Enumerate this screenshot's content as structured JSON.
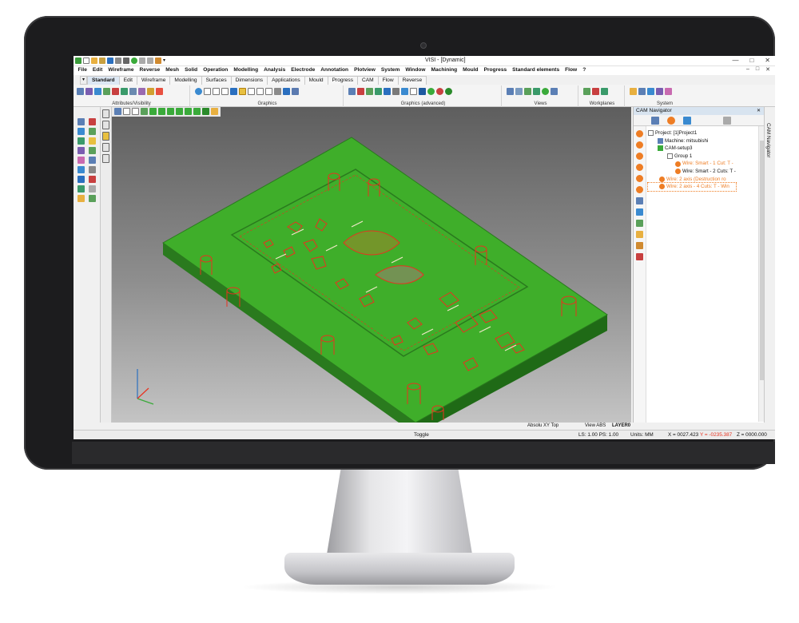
{
  "window": {
    "title": "VISI  - [Dynamic]",
    "controls": [
      "—",
      "□",
      "✕"
    ],
    "mdi_controls": [
      "–",
      "□",
      "✕"
    ]
  },
  "menu": [
    "File",
    "Edit",
    "Wireframe",
    "Reverse",
    "Mesh",
    "Solid",
    "Operation",
    "Modelling",
    "Analysis",
    "Electrode",
    "Annotation",
    "Plotview",
    "System",
    "Window",
    "Machining",
    "Mould",
    "Progress",
    "Standard elements",
    "Flow",
    "?"
  ],
  "ribbon_tabs": [
    {
      "label": "Standard",
      "active": true
    },
    {
      "label": "Edit"
    },
    {
      "label": "Wireframe"
    },
    {
      "label": "Modelling"
    },
    {
      "label": "Surfaces"
    },
    {
      "label": "Dimensions"
    },
    {
      "label": "Applications"
    },
    {
      "label": "Mould"
    },
    {
      "label": "Progress"
    },
    {
      "label": "CAM"
    },
    {
      "label": "Flow"
    },
    {
      "label": "Reverse"
    }
  ],
  "ribbon_groups": {
    "attributes": "Attributes/Visibility",
    "graphics": "Graphics",
    "graphics_adv": "Graphics (advanced)",
    "views": "Views",
    "workplanes": "Workplanes",
    "system": "System"
  },
  "cam_navigator": {
    "title": "CAM Navigator",
    "side_tab": "CAM Navigator",
    "tree": {
      "project": "Project: [1]Project1",
      "machine": "Machine: mitsubishi",
      "setup": "CAM-setup3",
      "group": "Group 1",
      "op1": "Wire: Smart - 1 Cut: T -",
      "op2": "Wire: Smart - 2 Cuts: T -",
      "op3": "Wire: 2 axis (Destruction ro",
      "op4": "Wire: 2 axis - 4 Cuts: T - Win"
    }
  },
  "status": {
    "view_name": "Absolu XY Top",
    "view_abs": "View ABS",
    "layer": "LAYER0",
    "toggle": "Toggle",
    "ls_ps": "LS: 1.00 PS: 1.00",
    "units": "Units: MM",
    "x": "X = 0027.423",
    "y": "Y = -0235.387",
    "z": "Z = 0000.000"
  },
  "colors": {
    "accent": "#2a6fbf",
    "model": "#3fae2a",
    "toolpath": "#e8321f",
    "orange_op": "#ee7d24"
  }
}
